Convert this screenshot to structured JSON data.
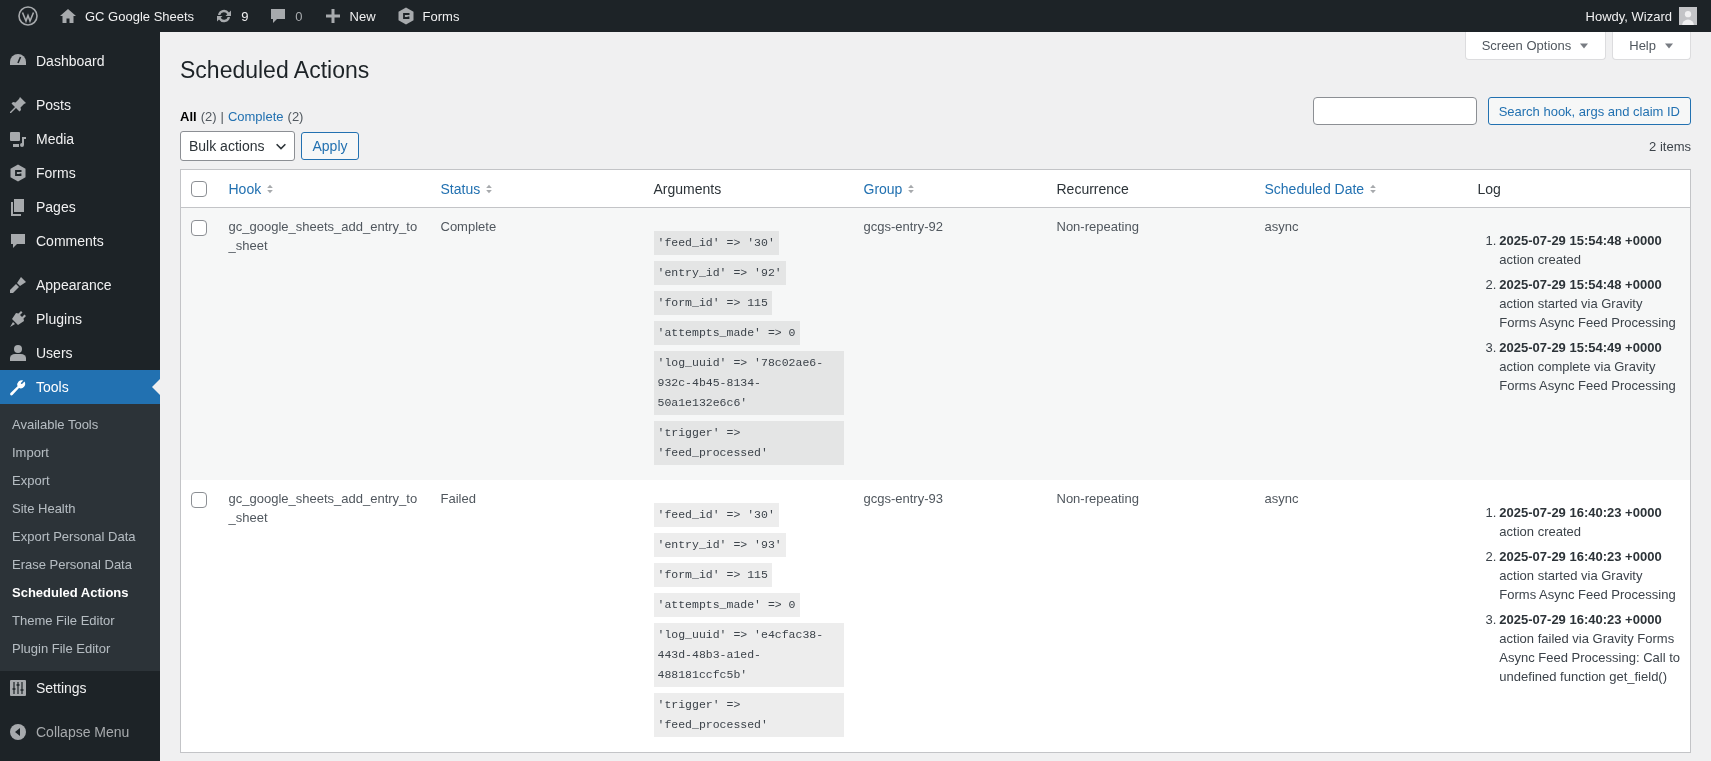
{
  "admin_bar": {
    "site_name": "GC Google Sheets",
    "updates_count": "9",
    "comments_count": "0",
    "new_label": "New",
    "forms_label": "Forms",
    "greeting": "Howdy, Wizard"
  },
  "sidebar": {
    "groups": [
      {
        "items": [
          {
            "label": "Dashboard",
            "selected": false
          }
        ]
      },
      {
        "items": [
          {
            "label": "Posts",
            "selected": false
          },
          {
            "label": "Media",
            "selected": false
          },
          {
            "label": "Forms",
            "selected": false
          },
          {
            "label": "Pages",
            "selected": false
          },
          {
            "label": "Comments",
            "selected": false
          }
        ]
      },
      {
        "items": [
          {
            "label": "Appearance",
            "selected": false
          },
          {
            "label": "Plugins",
            "selected": false
          },
          {
            "label": "Users",
            "selected": false
          },
          {
            "label": "Tools",
            "selected": true,
            "children": [
              {
                "label": "Available Tools",
                "selected": false
              },
              {
                "label": "Import",
                "selected": false
              },
              {
                "label": "Export",
                "selected": false
              },
              {
                "label": "Site Health",
                "selected": false
              },
              {
                "label": "Export Personal Data",
                "selected": false
              },
              {
                "label": "Erase Personal Data",
                "selected": false
              },
              {
                "label": "Scheduled Actions",
                "selected": true
              },
              {
                "label": "Theme File Editor",
                "selected": false
              },
              {
                "label": "Plugin File Editor",
                "selected": false
              }
            ]
          },
          {
            "label": "Settings",
            "selected": false
          }
        ]
      }
    ],
    "collapse_label": "Collapse Menu"
  },
  "screen_meta": [
    "Screen Options",
    "Help"
  ],
  "title": "Scheduled Actions",
  "views": [
    {
      "label": "All",
      "count": "(2)",
      "selected": true
    },
    {
      "label": "Complete",
      "count": "(2)",
      "selected": false
    }
  ],
  "views_separator": "|",
  "search": {
    "button": "Search hook, args and claim ID"
  },
  "bulk_actions": "Bulk actions",
  "apply": "Apply",
  "items_count": "2 items",
  "table": {
    "select_all_checked": false,
    "columns": [
      {
        "label": "Hook",
        "sortable": true
      },
      {
        "label": "Status",
        "sortable": true
      },
      {
        "label": "Arguments",
        "sortable": false
      },
      {
        "label": "Group",
        "sortable": true
      },
      {
        "label": "Recurrence",
        "sortable": false
      },
      {
        "label": "Scheduled Date",
        "sortable": true
      },
      {
        "label": "Log",
        "sortable": false
      }
    ],
    "rows": [
      {
        "checked": false,
        "hook": "gc_google_sheets_add_entry_to_sheet",
        "status": "Complete",
        "arguments": [
          "'feed_id' => '30'",
          "'entry_id' => '92'",
          "'form_id' => 115",
          "'attempts_made' => 0",
          "'log_uuid' => '78c02ae6-932c-4b45-8134-50a1e132e6c6'",
          "'trigger' => 'feed_processed'"
        ],
        "group": "gcgs-entry-92",
        "recurrence": "Non-repeating",
        "scheduled_date": "async",
        "log": [
          {
            "number": "1.",
            "time": "2025-07-29 15:54:48 +0000",
            "message": "action created"
          },
          {
            "number": "2.",
            "time": "2025-07-29 15:54:48 +0000",
            "message": "action started via Gravity Forms Async Feed Processing"
          },
          {
            "number": "3.",
            "time": "2025-07-29 15:54:49 +0000",
            "message": "action complete via Gravity Forms Async Feed Processing"
          }
        ]
      },
      {
        "checked": false,
        "hook": "gc_google_sheets_add_entry_to_sheet",
        "status": "Failed",
        "arguments": [
          "'feed_id' => '30'",
          "'entry_id' => '93'",
          "'form_id' => 115",
          "'attempts_made' => 0",
          "'log_uuid' => 'e4cfac38-443d-48b3-a1ed-488181ccfc5b'",
          "'trigger' => 'feed_processed'"
        ],
        "group": "gcgs-entry-93",
        "recurrence": "Non-repeating",
        "scheduled_date": "async",
        "log": [
          {
            "number": "1.",
            "time": "2025-07-29 16:40:23 +0000",
            "message": "action created"
          },
          {
            "number": "2.",
            "time": "2025-07-29 16:40:23 +0000",
            "message": "action started via Gravity Forms Async Feed Processing"
          },
          {
            "number": "3.",
            "time": "2025-07-29 16:40:23 +0000",
            "message": "action failed via Gravity Forms Async Feed Processing: Call to undefined function get_field()"
          }
        ]
      }
    ]
  }
}
